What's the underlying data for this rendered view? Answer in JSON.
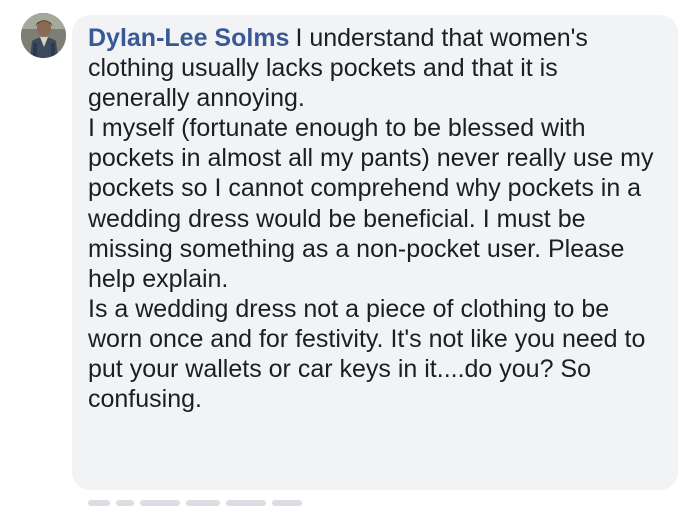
{
  "comment": {
    "author": "Dylan-Lee Solms",
    "paragraphs": [
      "I understand that women's clothing usually lacks pockets and that it is generally annoying.",
      "I myself (fortunate enough to be blessed with pockets in almost all my pants) never really use my pockets so I cannot comprehend why pockets in a wedding dress would be beneficial. I must be missing something as a non-pocket user. Please help explain.",
      "Is a wedding dress not a piece of clothing to be worn once and for festivity. It's not like you need to put your wallets or car keys in it....do you? So confusing."
    ]
  },
  "colors": {
    "author_link": "#385898",
    "bubble_bg": "#f2f3f5",
    "text": "#1c1e21"
  }
}
